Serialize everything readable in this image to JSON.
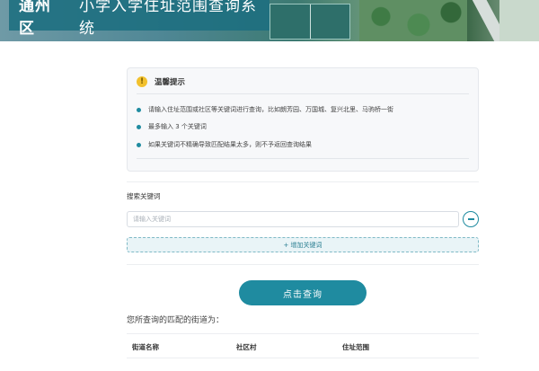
{
  "header": {
    "district": "通州区",
    "title": "小学入学住址范围查询系统"
  },
  "tips": {
    "icon": "warning-icon",
    "title": "温馨提示",
    "items": [
      "请输入住址范围或社区等关键词进行查询，比如朗芳园、万国城、复兴北里、马驹桥一街",
      "最多输入 3 个关键词",
      "如果关键词不精确导致匹配结果太多，则不予返回查询结果"
    ]
  },
  "search": {
    "label": "搜索关键词",
    "placeholder": "请输入关键词",
    "value": "",
    "add_label": "+ 增加关键词"
  },
  "query_button": "点击查询",
  "result": {
    "heading": "您所查询的匹配的街道为：",
    "columns": [
      "街道名称",
      "社区村",
      "住址范围"
    ]
  },
  "colors": {
    "accent": "#1f8ba0",
    "title_bg": "#1c6e80"
  }
}
